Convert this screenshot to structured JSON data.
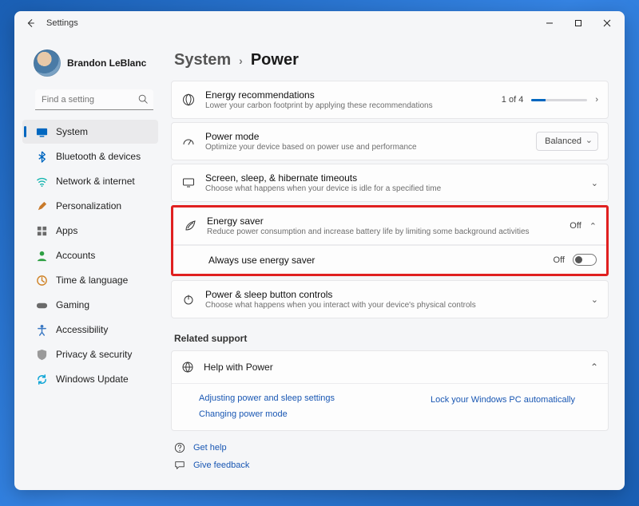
{
  "titlebar": {
    "title": "Settings"
  },
  "profile": {
    "name": "Brandon LeBlanc",
    "sub": ""
  },
  "search": {
    "placeholder": "Find a setting"
  },
  "nav": [
    {
      "label": "System",
      "active": true
    },
    {
      "label": "Bluetooth & devices"
    },
    {
      "label": "Network & internet"
    },
    {
      "label": "Personalization"
    },
    {
      "label": "Apps"
    },
    {
      "label": "Accounts"
    },
    {
      "label": "Time & language"
    },
    {
      "label": "Gaming"
    },
    {
      "label": "Accessibility"
    },
    {
      "label": "Privacy & security"
    },
    {
      "label": "Windows Update"
    }
  ],
  "breadcrumb": {
    "parent": "System",
    "current": "Power"
  },
  "rows": {
    "energy_rec": {
      "title": "Energy recommendations",
      "sub": "Lower your carbon footprint by applying these recommendations",
      "count": "1 of 4"
    },
    "power_mode": {
      "title": "Power mode",
      "sub": "Optimize your device based on power use and performance",
      "value": "Balanced"
    },
    "timeouts": {
      "title": "Screen, sleep, & hibernate timeouts",
      "sub": "Choose what happens when your device is idle for a specified time"
    },
    "energy_saver": {
      "title": "Energy saver",
      "sub": "Reduce power consumption and increase battery life by limiting some background activities",
      "status": "Off"
    },
    "always_on": {
      "title": "Always use energy saver",
      "status": "Off"
    },
    "buttons": {
      "title": "Power & sleep button controls",
      "sub": "Choose what happens when you interact with your device's physical controls"
    }
  },
  "related": {
    "heading": "Related support",
    "help_title": "Help with Power",
    "links": {
      "a": "Adjusting power and sleep settings",
      "b": "Lock your Windows PC automatically",
      "c": "Changing power mode"
    }
  },
  "footer": {
    "get_help": "Get help",
    "feedback": "Give feedback"
  }
}
